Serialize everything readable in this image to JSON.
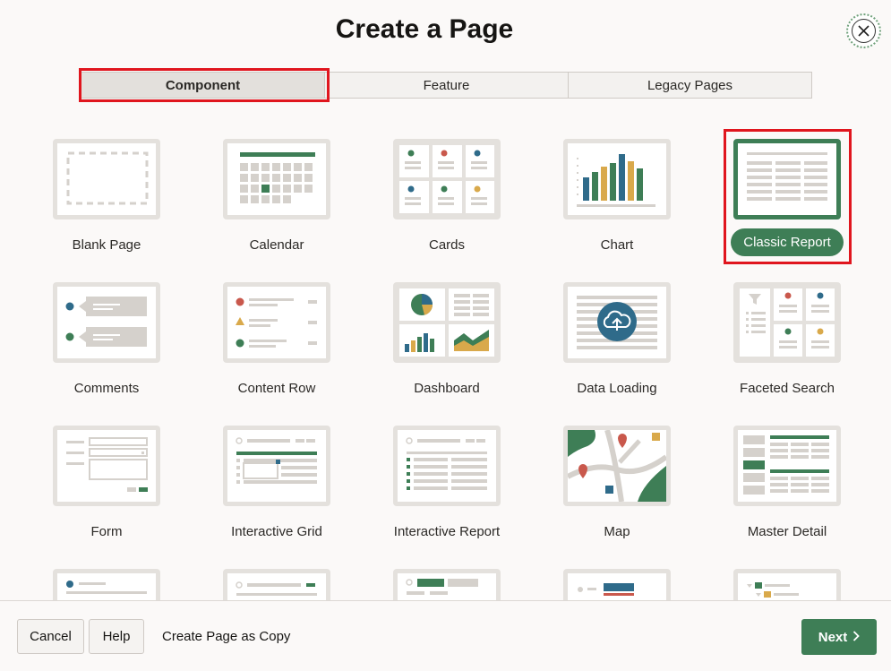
{
  "dialog": {
    "title": "Create a Page",
    "close_icon": "close-icon"
  },
  "tabs": [
    {
      "label": "Component",
      "active": true
    },
    {
      "label": "Feature",
      "active": false
    },
    {
      "label": "Legacy Pages",
      "active": false
    }
  ],
  "tiles": [
    {
      "label": "Blank Page",
      "icon": "blank-page-icon"
    },
    {
      "label": "Calendar",
      "icon": "calendar-icon"
    },
    {
      "label": "Cards",
      "icon": "cards-icon"
    },
    {
      "label": "Chart",
      "icon": "chart-icon"
    },
    {
      "label": "Classic Report",
      "icon": "classic-report-icon",
      "selected": true
    },
    {
      "label": "Comments",
      "icon": "comments-icon"
    },
    {
      "label": "Content Row",
      "icon": "content-row-icon"
    },
    {
      "label": "Dashboard",
      "icon": "dashboard-icon"
    },
    {
      "label": "Data Loading",
      "icon": "data-loading-icon"
    },
    {
      "label": "Faceted Search",
      "icon": "faceted-search-icon"
    },
    {
      "label": "Form",
      "icon": "form-icon"
    },
    {
      "label": "Interactive Grid",
      "icon": "interactive-grid-icon"
    },
    {
      "label": "Interactive Report",
      "icon": "interactive-report-icon"
    },
    {
      "label": "Map",
      "icon": "map-icon"
    },
    {
      "label": "Master Detail",
      "icon": "master-detail-icon"
    }
  ],
  "footer": {
    "cancel_label": "Cancel",
    "help_label": "Help",
    "copy_label": "Create Page as Copy",
    "next_label": "Next",
    "next_icon": "chevron-right-icon"
  },
  "colors": {
    "accent_green": "#3e7e56",
    "highlight_red": "#e0161e"
  }
}
